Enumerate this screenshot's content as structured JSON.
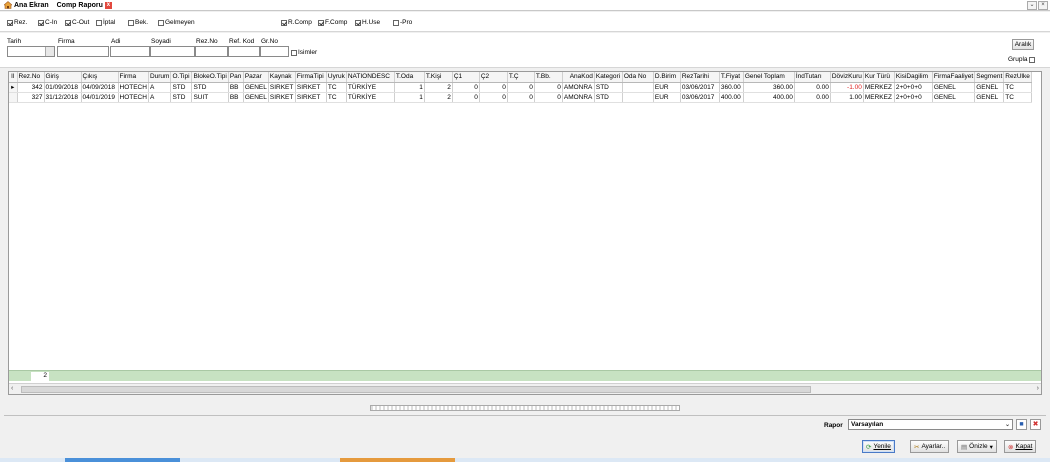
{
  "tabs": [
    {
      "label": "Ana Ekran",
      "icon": "home-icon"
    },
    {
      "label": "Comp Raporu",
      "icon": "close-icon"
    }
  ],
  "filters": {
    "checkboxes": [
      {
        "label": "Rez.",
        "checked": true
      },
      {
        "label": "C-In",
        "checked": true
      },
      {
        "label": "C-Out",
        "checked": true
      },
      {
        "label": "İptal",
        "checked": false
      },
      {
        "label": "Bek.",
        "checked": false
      },
      {
        "label": "Gelmeyen",
        "checked": false
      },
      {
        "label": "R.Comp",
        "checked": true
      },
      {
        "label": "F.Comp",
        "checked": true
      },
      {
        "label": "H.Use",
        "checked": true
      },
      {
        "label": "-Pro",
        "checked": false
      }
    ]
  },
  "search": {
    "labels": [
      "Tarih",
      "Firma",
      "Adi",
      "Soyadi",
      "Rez.No",
      "Ref. Kod",
      "Gr.No"
    ],
    "isimler_label": "Isimler",
    "aralik_label": "Aralık",
    "grupla_label": "Grupla"
  },
  "grid": {
    "columns": [
      "Rez.No",
      "Giriş",
      "Çıkış",
      "Firma",
      "Durum",
      "O.Tipi",
      "BlokeO.Tipi",
      "Pan",
      "Pazar",
      "Kaynak",
      "FirmaTipi",
      "Uyruk",
      "NATIONDESC",
      "T.Oda",
      "T.Kişi",
      "Ç1",
      "Ç2",
      "T.Ç",
      "T.Bb.",
      "AnaKod",
      "Kategori",
      "Oda No",
      "D.Birim",
      "RezTarihi",
      "T.Fiyat",
      "Genel Toplam",
      "İndTutarı",
      "DövizKuru",
      "Kur Türü",
      "KisiDagilim",
      "FirmaFaaliyet",
      "Segment",
      "RezUlke"
    ],
    "rows": [
      [
        "342",
        "01/09/2018",
        "04/09/2018",
        "HOTECH",
        "A",
        "STD",
        "STD",
        "BB",
        "GENEL",
        "SIRKET",
        "SIRKET",
        "TC",
        "TÜRKİYE",
        "1",
        "2",
        "0",
        "0",
        "0",
        "0",
        "AMONRA",
        "STD",
        "",
        "EUR",
        "03/06/2017",
        "360.00",
        "360.00",
        "0.00",
        "-1.00",
        "MERKEZ",
        "2+0+0+0",
        "GENEL",
        "GENEL",
        "TC"
      ],
      [
        "327",
        "31/12/2018",
        "04/01/2019",
        "HOTECH",
        "A",
        "STD",
        "SUIT",
        "BB",
        "GENEL",
        "SIRKET",
        "SIRKET",
        "TC",
        "TÜRKİYE",
        "1",
        "2",
        "0",
        "0",
        "0",
        "0",
        "AMONRA",
        "STD",
        "",
        "EUR",
        "03/06/2017",
        "400.00",
        "400.00",
        "0.00",
        "1.00",
        "MERKEZ",
        "2+0+0+0",
        "GENEL",
        "GENEL",
        "TC"
      ]
    ],
    "footer_count": "2"
  },
  "bottom": {
    "rapor_label": "Rapor",
    "rapor_value": "Varsayılan",
    "buttons": {
      "yenile": "Yenile",
      "ayarlar": "Ayarlar..",
      "onizle": "Önizle",
      "kapat": "Kapat"
    }
  }
}
